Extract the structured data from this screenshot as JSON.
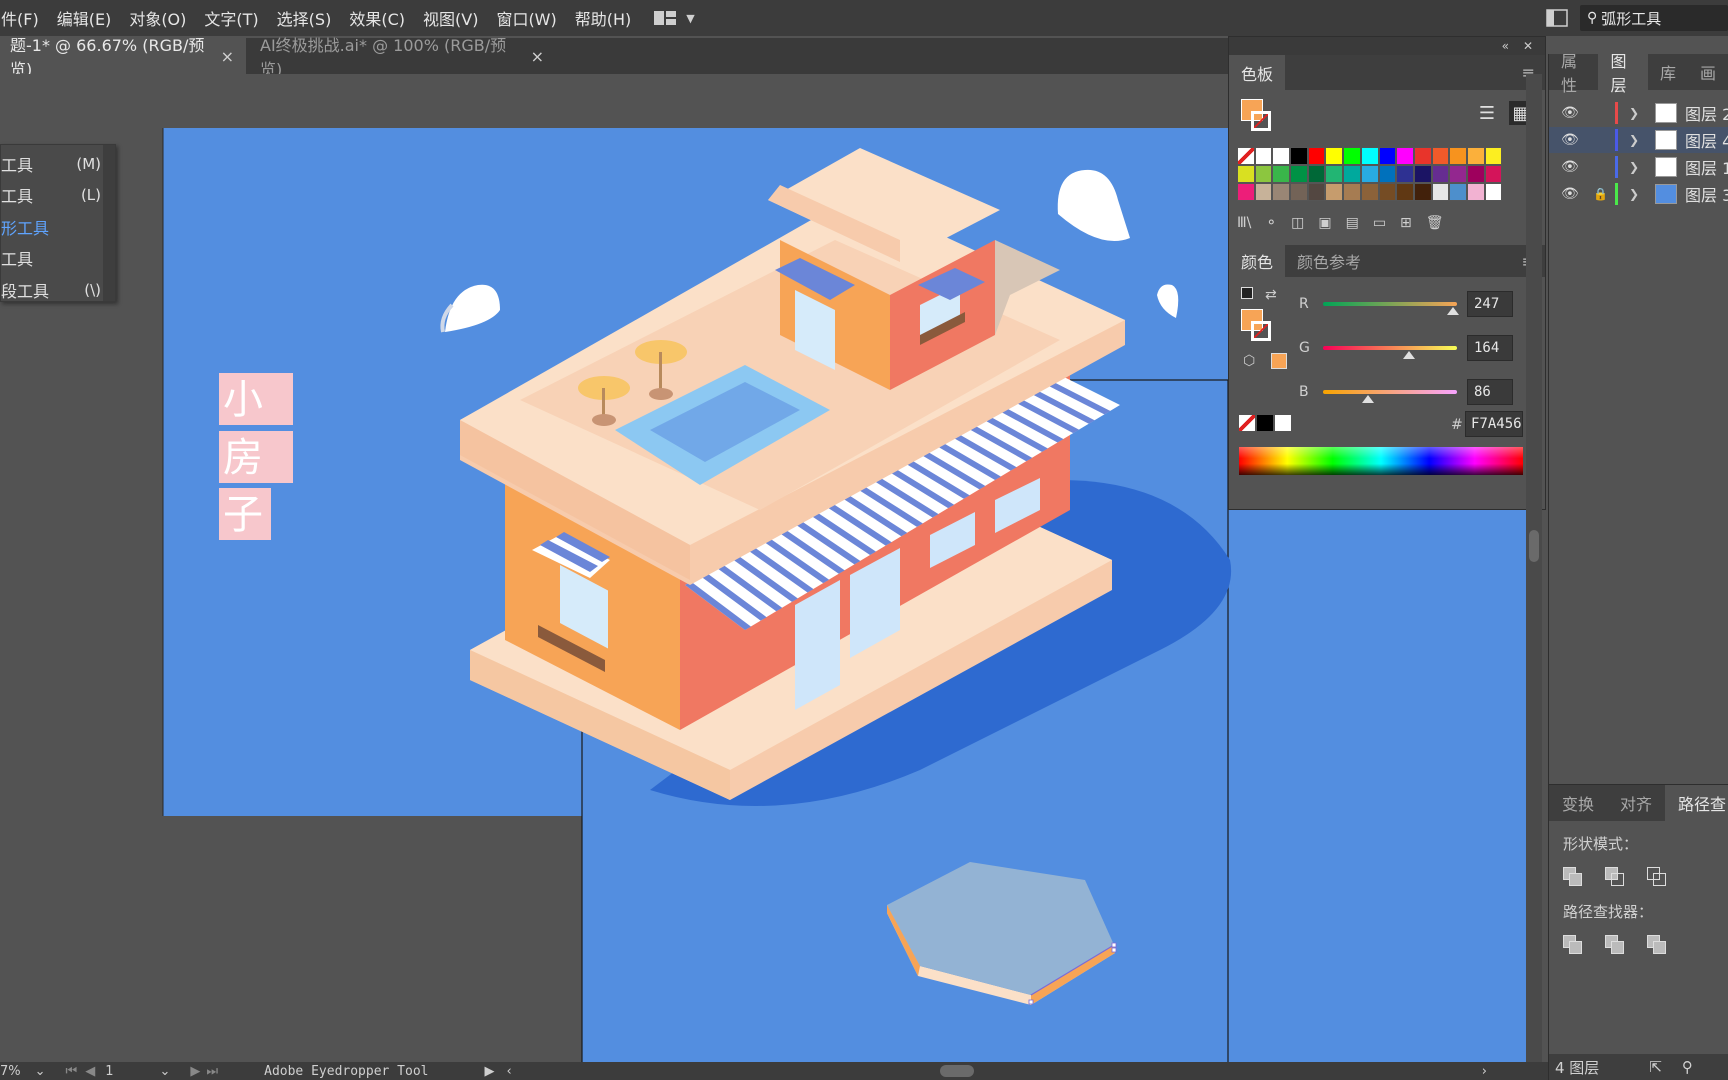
{
  "menubar": {
    "items": [
      "件(F)",
      "编辑(E)",
      "对象(O)",
      "文字(T)",
      "选择(S)",
      "效果(C)",
      "视图(V)",
      "窗口(W)",
      "帮助(H)"
    ],
    "search_value": "弧形工具"
  },
  "tabs": [
    {
      "label": "题-1* @ 66.67% (RGB/预览)",
      "close": "×"
    },
    {
      "label": "AI终极挑战.ai* @ 100% (RGB/预览)",
      "close": "×"
    }
  ],
  "flyout": {
    "items": [
      {
        "label": "工具",
        "shortcut": "(M)"
      },
      {
        "label": "工具",
        "shortcut": "(L)"
      },
      {
        "label": "形工具",
        "shortcut": ""
      },
      {
        "label": "工具",
        "shortcut": ""
      },
      {
        "label": "段工具",
        "shortcut": "(\\)"
      }
    ]
  },
  "artwork": {
    "title_chars": [
      "小",
      "房",
      "子"
    ],
    "colors": {
      "sky": "#538ee0",
      "shadow": "#2e6ad0",
      "cream": "#fbe0c8",
      "cream_dark": "#f7cbac",
      "orange": "#f7a456",
      "coral": "#f07862",
      "pool": "#8cc8f2",
      "stripe_blue": "#6b86d8",
      "hexagon_top": "#93b3d4",
      "title_box": "#f7c7cc"
    }
  },
  "swatches_panel": {
    "tab": "色板",
    "colors": [
      "#ffffff",
      "#ffffff",
      "#ffffff",
      "#000000",
      "#ff0000",
      "#ffff00",
      "#00ff00",
      "#00ffff",
      "#0000ff",
      "#ff00ff",
      "#e8342b",
      "#f15a2a",
      "#f7931e",
      "#fbb03b",
      "#fcee21",
      "#d9e021",
      "#8cc63f",
      "#39b54a",
      "#009245",
      "#006837",
      "#22b573",
      "#00a99d",
      "#29abe2",
      "#0071bc",
      "#2e3192",
      "#1b1464",
      "#662d91",
      "#93278f",
      "#9e005d",
      "#d4145a",
      "#ed1e79",
      "#c7b299",
      "#998675",
      "#736357",
      "#534741",
      "#c69c6d",
      "#a67c52",
      "#8c6239",
      "#754c24",
      "#603813",
      "#42210b",
      "#e6e6e6",
      "#4d8fcc",
      "#f2b2d2",
      "#ffffff"
    ]
  },
  "color_panel": {
    "tab": "颜色",
    "tab2": "颜色参考",
    "r": 247,
    "g": 164,
    "b": 86,
    "r_label": "R",
    "g_label": "G",
    "b_label": "B",
    "hex_prefix": "#",
    "hex": "F7A456",
    "fill_color": "#f7a456"
  },
  "dock": {
    "tabs": [
      "属性",
      "图层",
      "库",
      "画"
    ],
    "layers": [
      {
        "name": "图层 2",
        "color": "#e84a4a",
        "locked": false
      },
      {
        "name": "图层 4",
        "color": "#4a5ae8",
        "locked": false
      },
      {
        "name": "图层 1",
        "color": "#4a6ae8",
        "locked": false
      },
      {
        "name": "图层 3",
        "color": "#4ae84a",
        "locked": true
      }
    ],
    "pathfinder_tabs": [
      "变换",
      "对齐",
      "路径查"
    ],
    "shape_modes_label": "形状模式：",
    "pathfinders_label": "路径查找器：",
    "layer_count": "4 图层"
  },
  "statusbar": {
    "zoom": "7%",
    "page": "1",
    "tool": "Adobe Eyedropper Tool"
  }
}
